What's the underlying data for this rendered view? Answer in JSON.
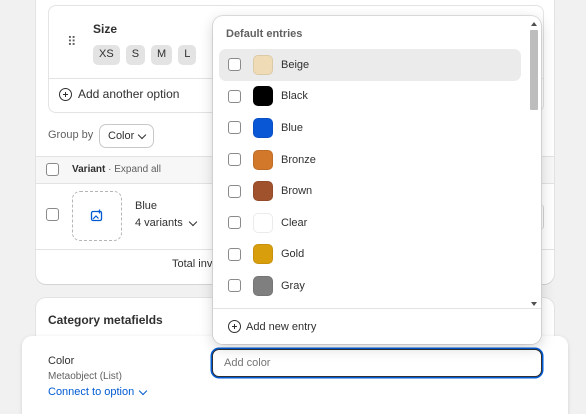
{
  "option": {
    "name": "Size",
    "values": [
      "XS",
      "S",
      "M",
      "L"
    ],
    "add_another_label": "Add another option"
  },
  "group_by": {
    "label": "Group by",
    "selected": "Color"
  },
  "table": {
    "variant_header": "Variant",
    "expand_all": "· Expand all"
  },
  "variant_row": {
    "name": "Blue",
    "count_label": "4 variants"
  },
  "total_inventory": "Total inv",
  "category_metafields": {
    "title": "Category metafields",
    "field_label": "Color",
    "field_type": "Metaobject (List)",
    "connect_label": "Connect to option",
    "input_placeholder": "Add color"
  },
  "dropdown": {
    "section_label": "Default entries",
    "entries": [
      {
        "label": "Beige",
        "color": "#efdcb6",
        "highlighted": true
      },
      {
        "label": "Black",
        "color": "#000000",
        "highlighted": false
      },
      {
        "label": "Blue",
        "color": "#0a57d6",
        "highlighted": false
      },
      {
        "label": "Bronze",
        "color": "#d1782b",
        "highlighted": false
      },
      {
        "label": "Brown",
        "color": "#a0522d",
        "highlighted": false
      },
      {
        "label": "Clear",
        "color": "#ffffff",
        "highlighted": false
      },
      {
        "label": "Gold",
        "color": "#d99e0c",
        "highlighted": false
      },
      {
        "label": "Gray",
        "color": "#7f7f7f",
        "highlighted": false
      }
    ],
    "add_new_label": "Add new entry"
  },
  "colors": {
    "link": "#005bd3",
    "focus_ring": "#005bd3",
    "text": "#303030"
  }
}
